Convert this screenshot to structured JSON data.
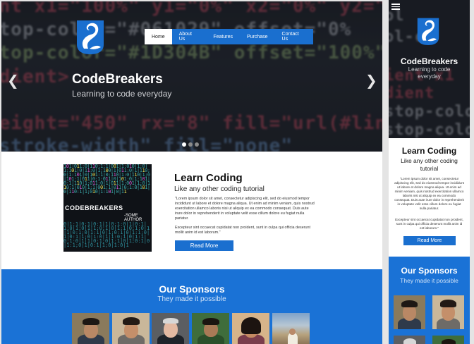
{
  "desktop": {
    "nav": {
      "items": [
        {
          "label": "Home",
          "active": true
        },
        {
          "label": "About Us",
          "active": false
        },
        {
          "label": "Features",
          "active": false
        },
        {
          "label": "Purchase",
          "active": false
        },
        {
          "label": "Contact Us",
          "active": false
        }
      ]
    },
    "hero": {
      "title": "CodeBreakers",
      "subtitle": "Learning to code everyday",
      "code_lines": [
        "ent x1=\"100%\" y1=\"0%\" x2=\"0%\" y2=\"",
        "stop-color=\"#061029\" offset=\"0%",
        "stop-color=\"#1D304B\" offset=\"100%\" />",
        "adient>",
        "",
        "",
        "height=\"450\" rx=\"8\" fill=\"url(#linear-g",
        "\"stroke-width\" fill=\"none\""
      ],
      "slides_total": 3,
      "slide_active": 1
    },
    "learn": {
      "title": "Learn Coding",
      "subtitle": "Like any other coding tutorial",
      "paragraph1": "\"Lorem ipsum dolor sit amet, consectetur adipiscing elit, sed do eiusmod tempor incididunt ut labore et dolore magna aliqua. Ut enim ad minim veniam, quis nostrud exercitation ullamco laboris nisi ut aliquip ex ea commodo consequat. Duis aute irure dolor in reprehenderit in voluptate velit esse cillum dolore eu fugiat nulla pariatur.",
      "paragraph2": "Excepteur sint occaecat cupidatat non proident, sunt in culpa qui officia deserunt mollit anim id est laborum.\"",
      "button": "Read More",
      "book": {
        "title": "CODEBREAKERS",
        "author": "-SOME AUTHOR"
      }
    },
    "sponsors": {
      "title": "Our Sponsors",
      "subtitle": "They made it possible"
    }
  },
  "mobile": {
    "hero": {
      "title": "CodeBreakers",
      "subtitle": "Learning to code everyday",
      "code_lines": [
        "ol",
        "ol-co",
        "ient x1",
        "dient",
        "stop-colo",
        "stop-colo"
      ]
    },
    "learn": {
      "title": "Learn Coding",
      "subtitle": "Like any other coding tutorial",
      "paragraph1": "\"Lorem ipsum dolor sit amet, consectetur adipiscing elit, sed do eiusmod tempor incididunt ut labore et dolore magna aliqua. Ut enim ad minim veniam, quis nostrud exercitation ullamco laboris nisi ut aliquip ex ea commodo consequat. Duis aute irure dolor in reprehenderit in voluptate velit esse cillum dolore eu fugiat nulla pariatur.",
      "paragraph2": "Excepteur sint occaecat cupidatat non proident, sunt in culpa qui officia deserunt mollit anim id est laborum.\"",
      "button": "Read More"
    },
    "sponsors": {
      "title": "Our Sponsors",
      "subtitle": "They made it possible"
    }
  },
  "colors": {
    "primary": "#1a6fcf",
    "sponsor_bg": "#1a72d6",
    "hero_bg": "#1b1e25"
  },
  "icons": {
    "menu": "hamburger-icon",
    "prev": "chevron-left-icon",
    "next": "chevron-right-icon",
    "logo": "swan-logo-icon"
  }
}
